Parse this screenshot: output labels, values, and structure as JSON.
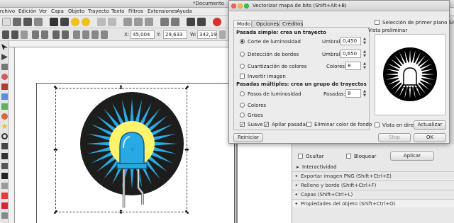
{
  "main_window": {
    "title": "*Documento",
    "menu": [
      "Archivo",
      "Edición",
      "Ver",
      "Capa",
      "Objeto",
      "Trayecto",
      "Texto",
      "Filtros",
      "Extensiones",
      "Ayuda"
    ],
    "coords": {
      "x_label": "X:",
      "x_value": "45,004",
      "y_label": "Y:",
      "y_value": "29,633",
      "w_label": "W:",
      "w_value": "342,19"
    }
  },
  "dialog": {
    "title": "Vectorizar mapa de bits (Shift+Alt+B)",
    "tabs": [
      "Modo",
      "Opciones",
      "Créditos"
    ],
    "single_scan": {
      "heading": "Pasada simple: crea un trayecto",
      "options": [
        {
          "label": "Corte de luminosidad",
          "param_label": "Umbral:",
          "value": "0,450",
          "selected": true
        },
        {
          "label": "Detección de bordes",
          "param_label": "Umbral:",
          "value": "0,650",
          "selected": false
        },
        {
          "label": "Cuantización de colores",
          "param_label": "Colores:",
          "value": "8",
          "selected": false
        }
      ],
      "invert": "Invertir imagen"
    },
    "multi_scan": {
      "heading": "Pasadas múltiples: crea un grupo de trayectos",
      "options": [
        {
          "label": "Pasos de luminosidad",
          "param_label": "Pasadas:",
          "value": "8",
          "selected": false
        },
        {
          "label": "Colores",
          "selected": false
        },
        {
          "label": "Grises",
          "selected": false
        }
      ],
      "smooth": "Suave",
      "stack": "Apilar pasadas",
      "remove_bg": "Eliminar color de fondo"
    },
    "siox": "Selección de primer plano SIOX",
    "preview_title": "Vista preliminar",
    "live_preview": "Vista en directo",
    "update_button": "Actualizar",
    "reset_button": "Reiniciar",
    "stop_button": "Stop",
    "ok_button": "OK"
  },
  "dock": {
    "hide": "Ocultar",
    "lock": "Bloquear",
    "apply": "Aplicar",
    "interactivity": "Interactividad",
    "panels": [
      "Exportar imagen PNG (Shift+Ctrl+E)",
      "Relleno y borde (Shift+Ctrl+F)",
      "Capas (Shift+Ctrl+L)",
      "Propiedades del objeto (Shift+Ctrl+O)"
    ]
  },
  "colors": {
    "accent_blue": "#29a9e1",
    "yellow": "#fff46b",
    "dark_circle": "#1d1d1b"
  }
}
